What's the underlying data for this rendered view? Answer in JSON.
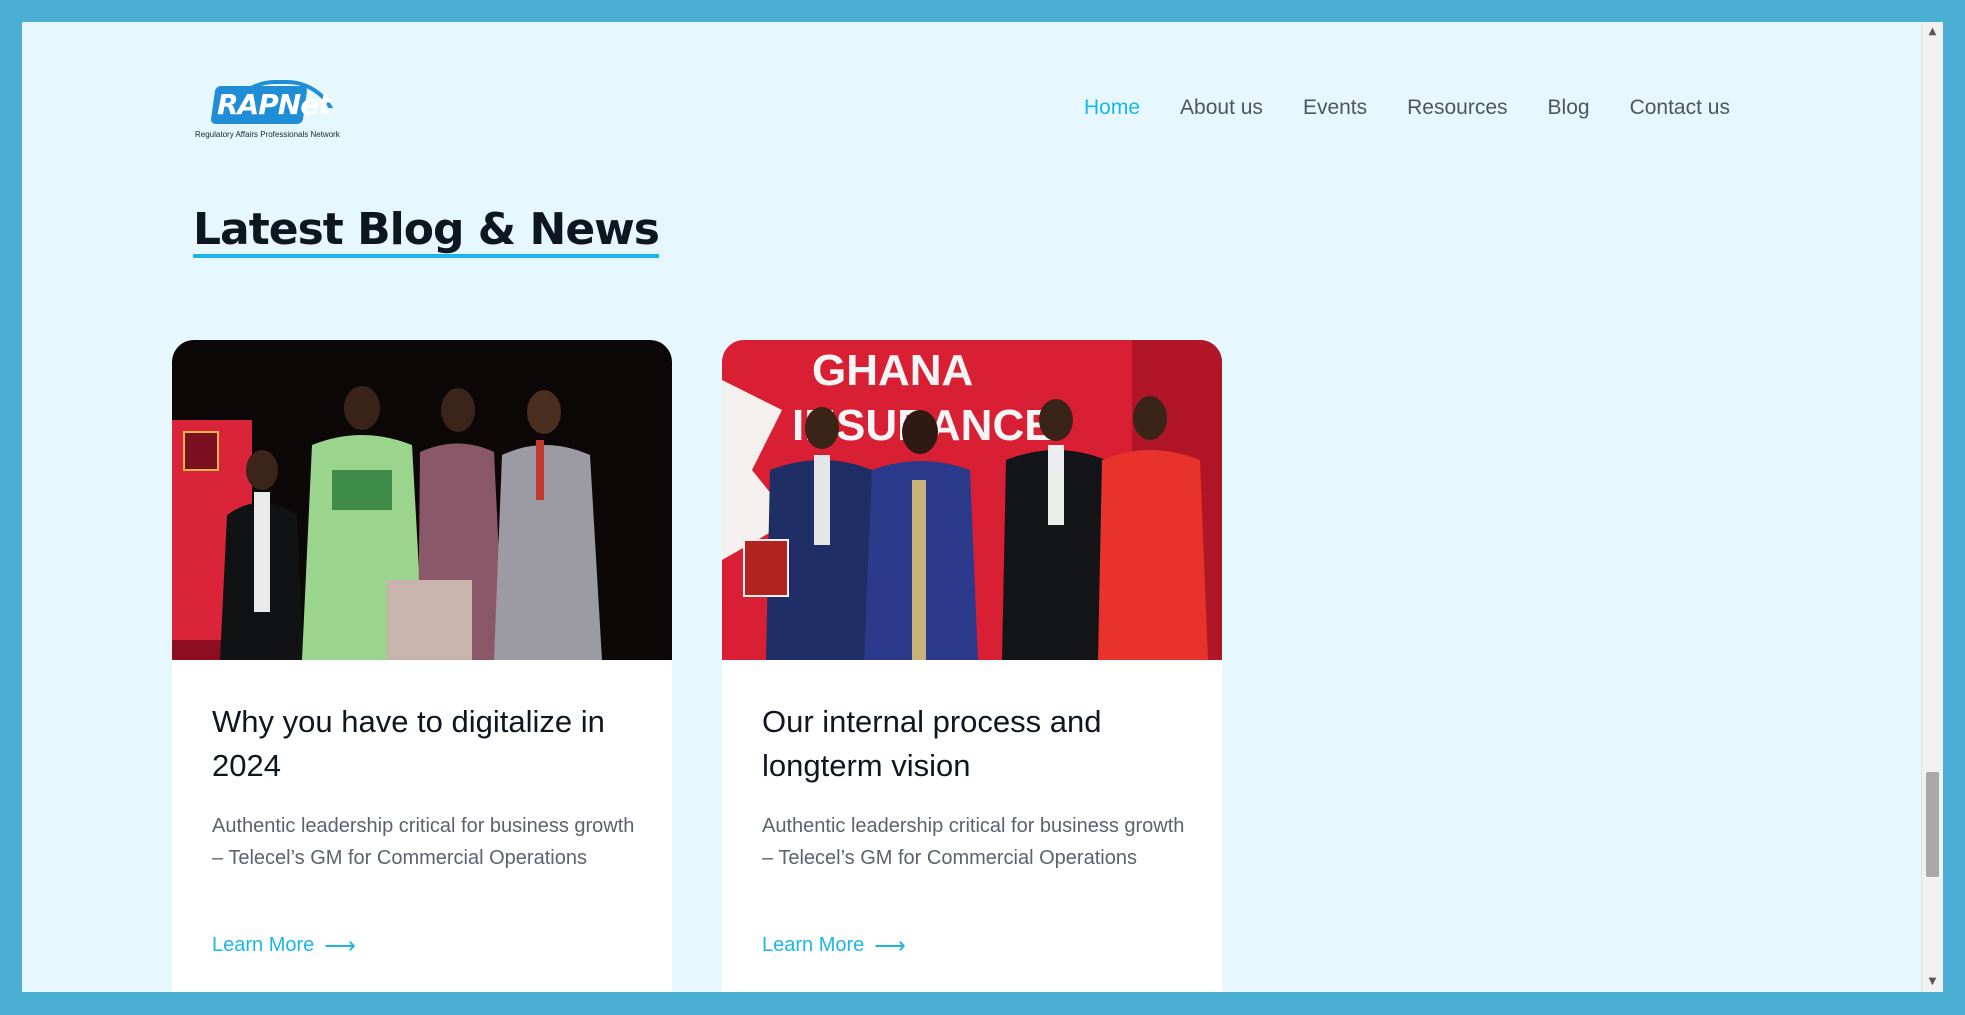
{
  "brand": {
    "logo_text_rap": "RAP",
    "logo_text_net": "Net",
    "tagline": "Regulatory Affairs Professionals Network",
    "accent_color": "#1cb6e6",
    "logo_color": "#1f8ed6"
  },
  "nav": {
    "items": [
      {
        "label": "Home",
        "active": true
      },
      {
        "label": "About us",
        "active": false
      },
      {
        "label": "Events",
        "active": false
      },
      {
        "label": "Resources",
        "active": false
      },
      {
        "label": "Blog",
        "active": false
      },
      {
        "label": "Contact us",
        "active": false
      }
    ]
  },
  "section": {
    "title": "Latest Blog & News"
  },
  "posts": [
    {
      "title": "Why you have to digitalize in 2024",
      "excerpt": "Authentic leadership critical for business growth – Telecel’s GM for Commercial Operations",
      "cta": "Learn More",
      "cta_icon": "arrow-right-icon"
    },
    {
      "title": "Our internal process and longterm vision",
      "excerpt": "Authentic leadership critical for business growth – Telecel’s GM for Commercial Operations",
      "cta": "Learn More",
      "cta_icon": "arrow-right-icon"
    }
  ]
}
